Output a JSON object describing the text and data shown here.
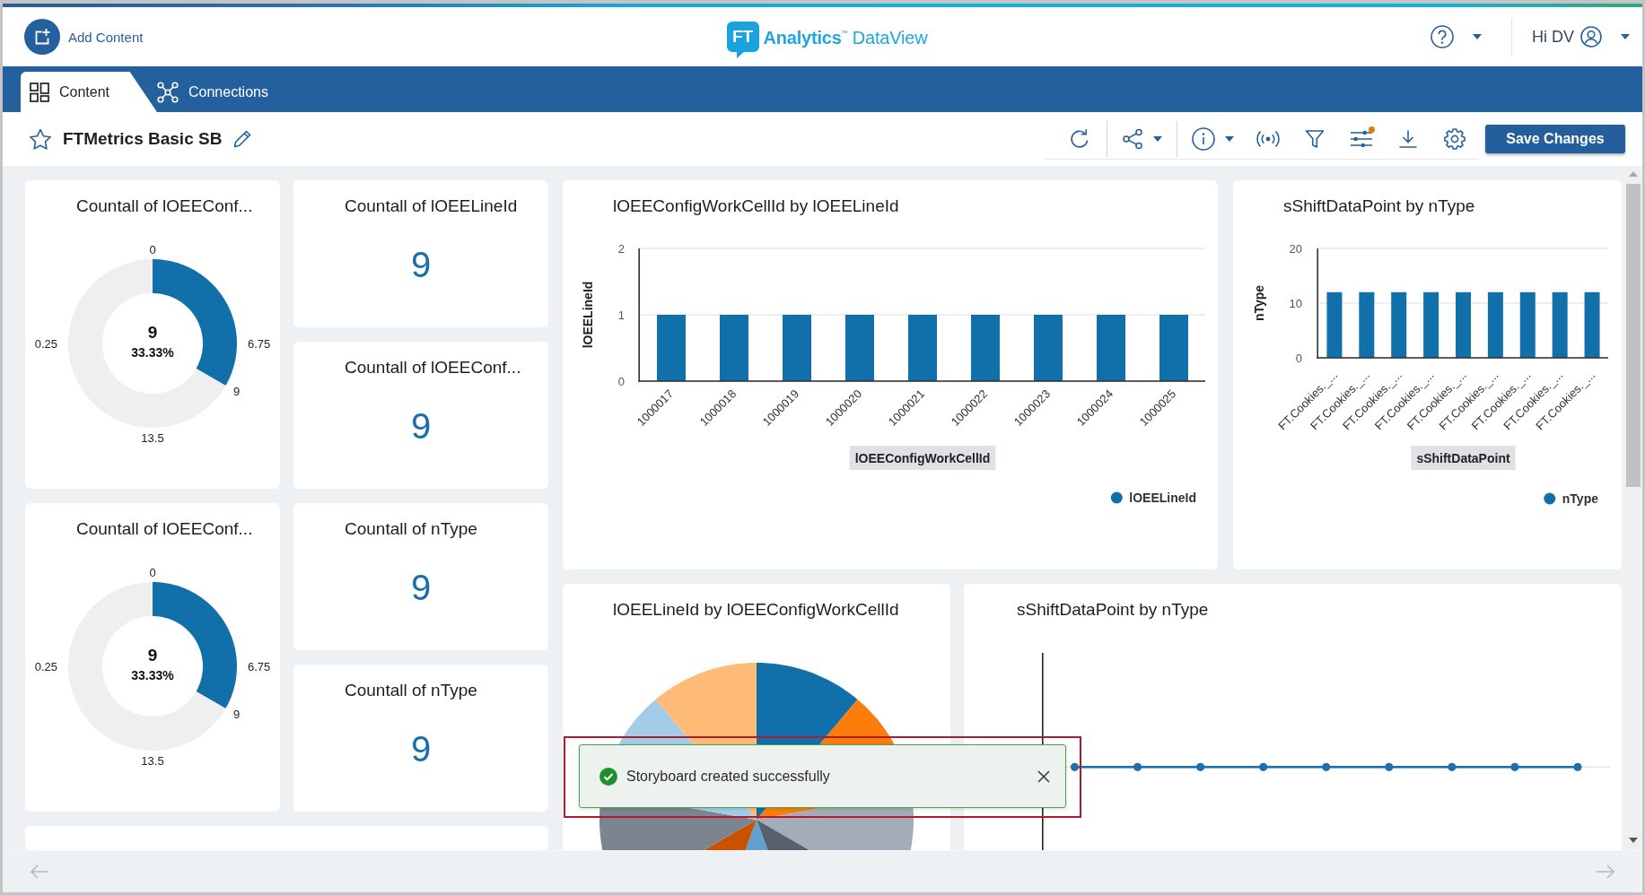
{
  "header": {
    "add_content": "Add Content",
    "logo": {
      "badge": "FT",
      "brand": "**Analytics**$^{™}$ DataView"
    },
    "greeting": "Hi DV"
  },
  "tabs": [
    {
      "label": "Content",
      "selected": true
    },
    {
      "label": "Connections",
      "selected": false
    }
  ],
  "toolbar": {
    "title": "FTMetrics Basic SB",
    "starred": false,
    "filters_badge": true,
    "save_label": "Save Changes"
  },
  "gauges": [
    {
      "title": "Countall of lOEEConf...",
      "value": "9",
      "percent": "33.33%",
      "marker": "9",
      "ticks": [
        "0",
        "6.75",
        "13.5",
        "0.25"
      ],
      "chart_data": {
        "type": "donut",
        "values": [
          33.33,
          66.67
        ]
      }
    },
    {
      "title": "Countall of lOEEConf...",
      "value": "9",
      "percent": "33.33%",
      "marker": "9",
      "ticks": [
        "0",
        "6.75",
        "13.5",
        "0.25"
      ],
      "chart_data": {
        "type": "donut",
        "values": [
          33.33,
          66.67
        ]
      }
    }
  ],
  "kpis": [
    {
      "title": "Countall of lOEELineId",
      "value": "9"
    },
    {
      "title": "Countall of lOEEConf...",
      "value": "9"
    },
    {
      "title": "Countall of nType",
      "value": "9"
    },
    {
      "title": "Countall of nType",
      "value": "9"
    }
  ],
  "bar_charts": [
    {
      "chart_data": {
        "type": "bar",
        "title": "lOEEConfigWorkCellId by lOEELineId",
        "xlabel": "lOEEConfigWorkCellId",
        "ylabel": "lOEELineId",
        "categories": [
          "1000017",
          "1000018",
          "1000019",
          "1000020",
          "1000021",
          "1000022",
          "1000023",
          "1000024",
          "1000025"
        ],
        "series": [
          {
            "name": "lOEELineId",
            "color": "#1170aa",
            "values": [
              1,
              1,
              1,
              1,
              1,
              1,
              1,
              1,
              1
            ]
          }
        ],
        "ylim": [
          0,
          2
        ],
        "yticks": [
          0,
          1,
          2
        ]
      }
    },
    {
      "chart_data": {
        "type": "bar",
        "title": "sShiftDataPoint by nType",
        "xlabel": "sShiftDataPoint",
        "ylabel": "nType",
        "categories": [
          "FT.Cookies._...",
          "FT.Cookies._...",
          "FT.Cookies._...",
          "FT.Cookies._...",
          "FT.Cookies._...",
          "FT.Cookies._...",
          "FT.Cookies._...",
          "FT.Cookies._...",
          "FT.Cookies._..."
        ],
        "series": [
          {
            "name": "nType",
            "color": "#1170aa",
            "values": [
              12,
              12,
              12,
              12,
              12,
              12,
              12,
              12,
              12
            ]
          }
        ],
        "ylim": [
          0,
          20
        ],
        "yticks": [
          0,
          10,
          20
        ]
      }
    }
  ],
  "pie_chart": {
    "title": "lOEELineId by lOEEConfigWorkCellId"
  },
  "line_chart": {
    "title": "sShiftDataPoint by nType"
  },
  "toast": {
    "kind": "success",
    "message": "Storyboard created successfully",
    "highlighted": true
  }
}
